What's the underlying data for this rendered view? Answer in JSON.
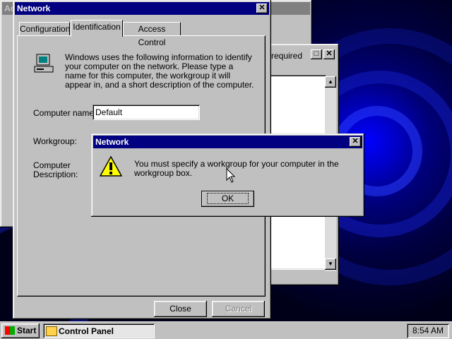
{
  "background_window": {
    "title_fragment": "Ac",
    "required_text": "required"
  },
  "network_props": {
    "title": "Network",
    "close_glyph": "✕",
    "tabs": [
      "Configuration",
      "Identification",
      "Access Control"
    ],
    "active_tab": "Identification",
    "description": "Windows uses the following information to identify your computer on the network.  Please type a name for this computer, the workgroup it will appear in, and a short description of the computer.",
    "computer_name_label": "Computer name:",
    "computer_name_value": "Default",
    "workgroup_label": "Workgroup:",
    "computer_description_label": "Computer\nDescription:",
    "close_button": "Close",
    "cancel_button": "Cancel"
  },
  "alert": {
    "title": "Network",
    "close_glyph": "✕",
    "message": "You must specify a workgroup for your computer in the workgroup box.",
    "ok_button": "OK",
    "icon": "warning-icon"
  },
  "taskbar": {
    "start_label": "Start",
    "task_label": "Control Panel",
    "clock": "8:54 AM"
  },
  "colors": {
    "title_active": "#000080",
    "face": "#c0c0c0",
    "desktop_accent": "#0000ff"
  }
}
